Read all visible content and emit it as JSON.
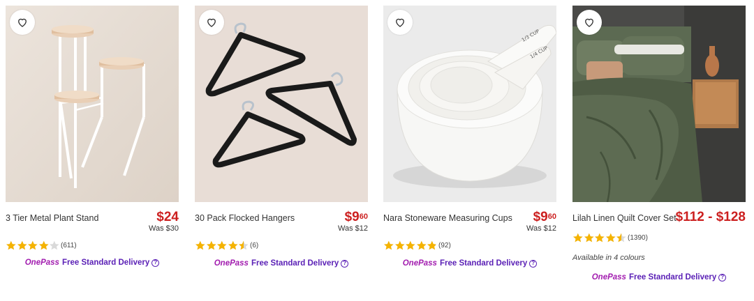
{
  "colors": {
    "price": "#cc1f1f",
    "star": "#f5b301",
    "onepass_brand": "#a21caf",
    "delivery": "#5b21b6"
  },
  "icons": {
    "wishlist": "heart-outline-icon",
    "info": "info-circle-icon",
    "star": "star-icon"
  },
  "products": [
    {
      "title": "3 Tier Metal Plant Stand",
      "price_main": "$24",
      "price_cents": "",
      "was": "Was $30",
      "rating": 4.0,
      "review_count": "(611)",
      "onepass_brand": "OnePass",
      "delivery": "Free Standard Delivery",
      "colours": ""
    },
    {
      "title": "30 Pack Flocked Hangers",
      "price_main": "$9",
      "price_cents": "60",
      "was": "Was $12",
      "rating": 4.5,
      "review_count": "(6)",
      "onepass_brand": "OnePass",
      "delivery": "Free Standard Delivery",
      "colours": ""
    },
    {
      "title": "Nara Stoneware Measuring Cups",
      "price_main": "$9",
      "price_cents": "60",
      "was": "Was $12",
      "rating": 4.8,
      "review_count": "(92)",
      "onepass_brand": "OnePass",
      "delivery": "Free Standard Delivery",
      "colours": ""
    },
    {
      "title": "Lilah Linen Quilt Cover Set",
      "price_main": "$112 - $128",
      "price_cents": "",
      "was": "",
      "rating": 4.5,
      "review_count": "(1390)",
      "onepass_brand": "OnePass",
      "delivery": "Free Standard Delivery",
      "colours": "Available in 4 colours"
    }
  ]
}
